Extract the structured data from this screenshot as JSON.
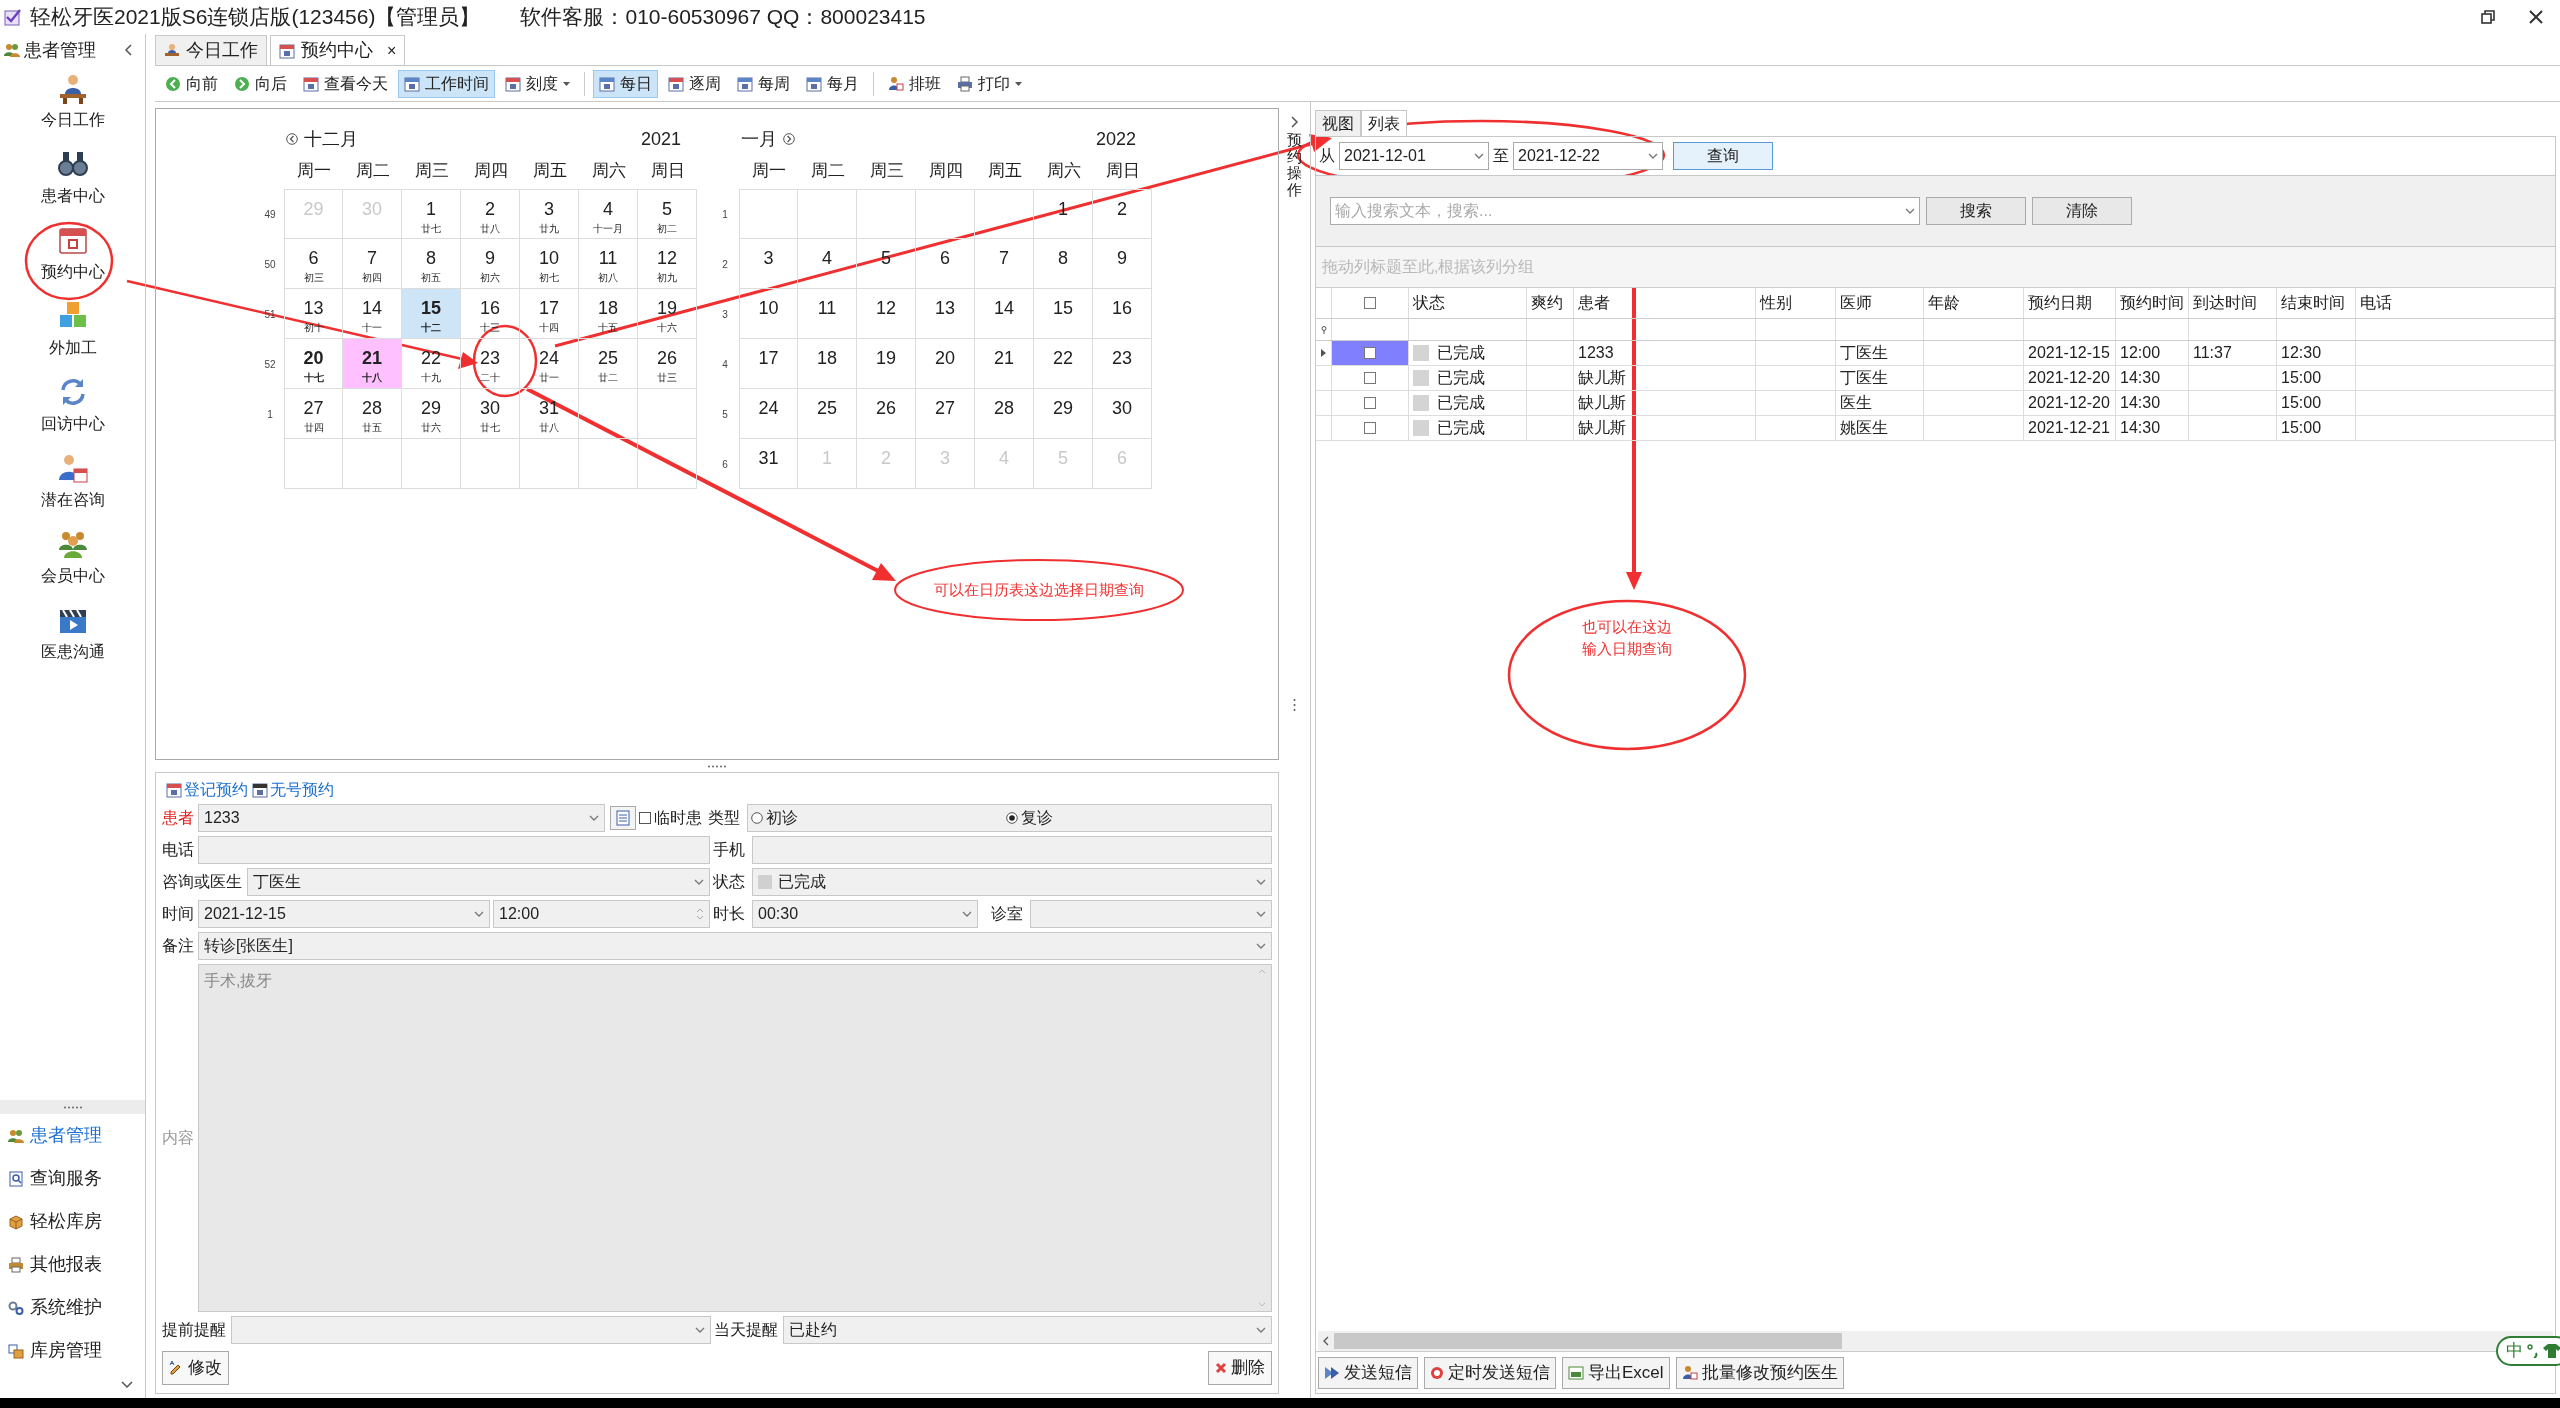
{
  "window": {
    "title": "轻松牙医2021版S6连锁店版(123456)【管理员】",
    "support": "软件客服：010-60530967 QQ：800023415"
  },
  "sidebar": {
    "title": "患者管理",
    "items": [
      {
        "label": "今日工作"
      },
      {
        "label": "患者中心"
      },
      {
        "label": "预约中心"
      },
      {
        "label": "外加工"
      },
      {
        "label": "回访中心"
      },
      {
        "label": "潜在咨询"
      },
      {
        "label": "会员中心"
      },
      {
        "label": "医患沟通"
      }
    ],
    "nav": [
      {
        "label": "患者管理",
        "selected": true
      },
      {
        "label": "查询服务",
        "selected": false
      },
      {
        "label": "轻松库房",
        "selected": false
      },
      {
        "label": "其他报表",
        "selected": false
      },
      {
        "label": "系统维护",
        "selected": false
      },
      {
        "label": "库房管理",
        "selected": false
      }
    ]
  },
  "tabs": [
    {
      "label": "今日工作",
      "selected": false
    },
    {
      "label": "预约中心",
      "selected": true,
      "close": "×"
    }
  ],
  "toolbar": [
    [
      {
        "label": "向前",
        "selected": false,
        "dropdown": false
      },
      {
        "label": "向后",
        "selected": false,
        "dropdown": false
      },
      {
        "label": "查看今天",
        "selected": false,
        "dropdown": false
      },
      {
        "label": "工作时间",
        "selected": true,
        "dropdown": false
      },
      {
        "label": "刻度",
        "selected": false,
        "dropdown": true
      }
    ],
    [
      {
        "label": "每日",
        "selected": true,
        "dropdown": false
      },
      {
        "label": "逐周",
        "selected": false,
        "dropdown": false
      },
      {
        "label": "每周",
        "selected": false,
        "dropdown": false
      },
      {
        "label": "每月",
        "selected": false,
        "dropdown": false
      }
    ],
    [
      {
        "label": "排班",
        "selected": false,
        "dropdown": false
      },
      {
        "label": "打印",
        "selected": false,
        "dropdown": true
      }
    ]
  ],
  "calendar": {
    "months": [
      {
        "month": "十二月",
        "year": "2021",
        "weekdays": [
          "周一",
          "周二",
          "周三",
          "周四",
          "周五",
          "周六",
          "周日"
        ],
        "weeks": [
          {
            "week": "49",
            "days": [
              {
                "day": "29",
                "kind": "muted"
              },
              {
                "day": "30",
                "kind": "muted"
              },
              {
                "day": "1",
                "lunar": "廿七",
                "kind": "normal"
              },
              {
                "day": "2",
                "lunar": "廿八",
                "kind": "normal"
              },
              {
                "day": "3",
                "lunar": "廿九",
                "kind": "normal"
              },
              {
                "day": "4",
                "lunar": "十一月",
                "kind": "normal"
              },
              {
                "day": "5",
                "lunar": "初二",
                "kind": "normal"
              }
            ]
          },
          {
            "week": "50",
            "days": [
              {
                "day": "6",
                "lunar": "初三",
                "kind": "normal"
              },
              {
                "day": "7",
                "lunar": "初四",
                "kind": "normal"
              },
              {
                "day": "8",
                "lunar": "初五",
                "kind": "normal"
              },
              {
                "day": "9",
                "lunar": "初六",
                "kind": "normal"
              },
              {
                "day": "10",
                "lunar": "初七",
                "kind": "normal"
              },
              {
                "day": "11",
                "lunar": "初八",
                "kind": "normal"
              },
              {
                "day": "12",
                "lunar": "初九",
                "kind": "normal"
              }
            ]
          },
          {
            "week": "51",
            "days": [
              {
                "day": "13",
                "lunar": "初十",
                "kind": "normal"
              },
              {
                "day": "14",
                "lunar": "十一",
                "kind": "normal"
              },
              {
                "day": "15",
                "lunar": "十二",
                "kind": "selected"
              },
              {
                "day": "16",
                "lunar": "十三",
                "kind": "normal"
              },
              {
                "day": "17",
                "lunar": "十四",
                "kind": "normal"
              },
              {
                "day": "18",
                "lunar": "十五",
                "kind": "normal"
              },
              {
                "day": "19",
                "lunar": "十六",
                "kind": "normal"
              }
            ]
          },
          {
            "week": "52",
            "days": [
              {
                "day": "20",
                "lunar": "十七",
                "kind": "today"
              },
              {
                "day": "21",
                "lunar": "十八",
                "kind": "marked"
              },
              {
                "day": "22",
                "lunar": "十九",
                "kind": "normal"
              },
              {
                "day": "23",
                "lunar": "二十",
                "kind": "normal"
              },
              {
                "day": "24",
                "lunar": "廿一",
                "kind": "normal"
              },
              {
                "day": "25",
                "lunar": "廿二",
                "kind": "normal"
              },
              {
                "day": "26",
                "lunar": "廿三",
                "kind": "normal"
              }
            ]
          },
          {
            "week": "1",
            "days": [
              {
                "day": "27",
                "lunar": "廿四",
                "kind": "normal"
              },
              {
                "day": "28",
                "lunar": "廿五",
                "kind": "normal"
              },
              {
                "day": "29",
                "lunar": "廿六",
                "kind": "normal"
              },
              {
                "day": "30",
                "lunar": "廿七",
                "kind": "normal"
              },
              {
                "day": "31",
                "lunar": "廿八",
                "kind": "normal"
              }
            ]
          }
        ]
      },
      {
        "month": "一月",
        "year": "2022",
        "weekdays": [
          "周一",
          "周二",
          "周三",
          "周四",
          "周五",
          "周六",
          "周日"
        ],
        "weeks": [
          {
            "week": "1",
            "days": [
              {
                "day": "1",
                "kind": "normal"
              },
              {
                "day": "2",
                "kind": "normal"
              }
            ]
          },
          {
            "week": "2",
            "days": [
              {
                "day": "3",
                "kind": "normal"
              },
              {
                "day": "4",
                "kind": "normal"
              },
              {
                "day": "5",
                "kind": "normal"
              },
              {
                "day": "6",
                "kind": "normal"
              },
              {
                "day": "7",
                "kind": "normal"
              },
              {
                "day": "8",
                "kind": "normal"
              },
              {
                "day": "9",
                "kind": "normal"
              }
            ]
          },
          {
            "week": "3",
            "days": [
              {
                "day": "10",
                "kind": "normal"
              },
              {
                "day": "11",
                "kind": "normal"
              },
              {
                "day": "12",
                "kind": "normal"
              },
              {
                "day": "13",
                "kind": "normal"
              },
              {
                "day": "14",
                "kind": "normal"
              },
              {
                "day": "15",
                "kind": "normal"
              },
              {
                "day": "16",
                "kind": "normal"
              }
            ]
          },
          {
            "week": "4",
            "days": [
              {
                "day": "17",
                "kind": "normal"
              },
              {
                "day": "18",
                "kind": "normal"
              },
              {
                "day": "19",
                "kind": "normal"
              },
              {
                "day": "20",
                "kind": "normal"
              },
              {
                "day": "21",
                "kind": "normal"
              },
              {
                "day": "22",
                "kind": "normal"
              },
              {
                "day": "23",
                "kind": "normal"
              }
            ]
          },
          {
            "week": "5",
            "days": [
              {
                "day": "24",
                "kind": "normal"
              },
              {
                "day": "25",
                "kind": "normal"
              },
              {
                "day": "26",
                "kind": "normal"
              },
              {
                "day": "27",
                "kind": "normal"
              },
              {
                "day": "28",
                "kind": "normal"
              },
              {
                "day": "29",
                "kind": "normal"
              },
              {
                "day": "30",
                "kind": "normal"
              }
            ]
          },
          {
            "week": "6",
            "days": [
              {
                "day": "31",
                "kind": "normal"
              },
              {
                "day": "1",
                "kind": "muted"
              },
              {
                "day": "2",
                "kind": "muted"
              },
              {
                "day": "3",
                "kind": "muted"
              },
              {
                "day": "4",
                "kind": "muted"
              },
              {
                "day": "5",
                "kind": "muted"
              },
              {
                "day": "6",
                "kind": "muted"
              }
            ]
          }
        ]
      }
    ]
  },
  "form": {
    "tabs": [
      {
        "label": "登记预约"
      },
      {
        "label": "无号预约"
      }
    ],
    "patient_label": "患者",
    "patient": "1233",
    "temp_label": "临时患",
    "temp_checked": false,
    "type_label": "类型",
    "types": [
      {
        "label": "初诊",
        "selected": false
      },
      {
        "label": "复诊",
        "selected": true
      }
    ],
    "phone_label": "电话",
    "mobile_label": "手机",
    "doctor_label": "咨询或医生",
    "doctor": "丁医生",
    "status_label": "状态",
    "status": "已完成",
    "time_label": "时间",
    "date": "2021-12-15",
    "time": "12:00",
    "duration_label": "时长",
    "duration": "00:30",
    "room_label": "诊室",
    "note_label": "备注",
    "note": "转诊[张医生]",
    "content_label": "内容",
    "content": "手术,拔牙",
    "advance_label": "提前提醒",
    "sameday_label": "当天提醒",
    "sameday": "已赴约",
    "edit_button": "修改",
    "delete_button": "删除"
  },
  "side_strip": {
    "label": "预约操作"
  },
  "right": {
    "tabs": [
      {
        "label": "视图",
        "selected": false
      },
      {
        "label": "列表",
        "selected": true
      }
    ],
    "query": {
      "from_label": "从",
      "from": "2021-12-01",
      "to_label": "至",
      "to": "2021-12-22",
      "button": "查询"
    },
    "search": {
      "placeholder": "输入搜索文本，搜索...",
      "search_button": "搜索",
      "clear_button": "清除"
    },
    "group_hint": "拖动列标题至此,根据该列分组",
    "table": {
      "columns": [
        "状态",
        "爽约",
        "患者",
        "性别",
        "医师",
        "年龄",
        "预约日期",
        "预约时间",
        "到达时间",
        "结束时间",
        "电话"
      ],
      "rows": [
        {
          "selected": true,
          "checked": false,
          "status": "已完成",
          "patient": "1233",
          "doctor": "丁医生",
          "date": "2021-12-15",
          "time": "12:00",
          "arrival": "11:37",
          "end": "12:30"
        },
        {
          "selected": false,
          "checked": false,
          "status": "已完成",
          "patient": "缺儿斯",
          "doctor": "丁医生",
          "date": "2021-12-20",
          "time": "14:30",
          "end": "15:00"
        },
        {
          "selected": false,
          "checked": false,
          "status": "已完成",
          "patient": "缺儿斯",
          "doctor": "医生",
          "date": "2021-12-20",
          "time": "14:30",
          "end": "15:00"
        },
        {
          "selected": false,
          "checked": false,
          "status": "已完成",
          "patient": "缺儿斯",
          "doctor": "姚医生",
          "date": "2021-12-21",
          "time": "14:30",
          "end": "15:00"
        }
      ]
    },
    "buttons": [
      "发送短信",
      "定时发送短信",
      "导出Excel",
      "批量修改预约医生"
    ]
  },
  "ime": {
    "label": "中"
  },
  "annotations": [
    {
      "lines": [
        "可以在日历表这边选择日期查询"
      ]
    },
    {
      "lines": [
        "也可以在这边",
        "输入日期查询"
      ]
    }
  ]
}
